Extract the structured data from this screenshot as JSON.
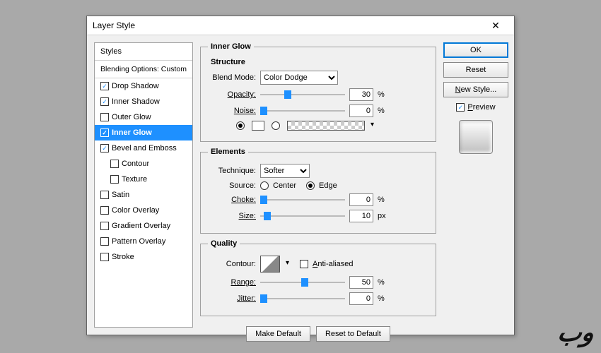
{
  "title": "Layer Style",
  "styles_header": "Styles",
  "blending_options": "Blending Options: Custom",
  "effects": [
    {
      "label": "Drop Shadow",
      "checked": true,
      "selected": false,
      "nest": false
    },
    {
      "label": "Inner Shadow",
      "checked": true,
      "selected": false,
      "nest": false
    },
    {
      "label": "Outer Glow",
      "checked": false,
      "selected": false,
      "nest": false
    },
    {
      "label": "Inner Glow",
      "checked": true,
      "selected": true,
      "nest": false
    },
    {
      "label": "Bevel and Emboss",
      "checked": true,
      "selected": false,
      "nest": false
    },
    {
      "label": "Contour",
      "checked": false,
      "selected": false,
      "nest": true
    },
    {
      "label": "Texture",
      "checked": false,
      "selected": false,
      "nest": true
    },
    {
      "label": "Satin",
      "checked": false,
      "selected": false,
      "nest": false
    },
    {
      "label": "Color Overlay",
      "checked": false,
      "selected": false,
      "nest": false
    },
    {
      "label": "Gradient Overlay",
      "checked": false,
      "selected": false,
      "nest": false
    },
    {
      "label": "Pattern Overlay",
      "checked": false,
      "selected": false,
      "nest": false
    },
    {
      "label": "Stroke",
      "checked": false,
      "selected": false,
      "nest": false
    }
  ],
  "panel_title": "Inner Glow",
  "structure": {
    "heading": "Structure",
    "blend_mode_label": "Blend Mode:",
    "blend_mode_value": "Color Dodge",
    "opacity_label": "Opacity:",
    "opacity_value": "30",
    "opacity_unit": "%",
    "noise_label": "Noise:",
    "noise_value": "0",
    "noise_unit": "%",
    "color_mode": "solid"
  },
  "elements": {
    "heading": "Elements",
    "technique_label": "Technique:",
    "technique_value": "Softer",
    "source_label": "Source:",
    "source_center": "Center",
    "source_edge": "Edge",
    "source_value": "Edge",
    "choke_label": "Choke:",
    "choke_value": "0",
    "choke_unit": "%",
    "size_label": "Size:",
    "size_value": "10",
    "size_unit": "px"
  },
  "quality": {
    "heading": "Quality",
    "contour_label": "Contour:",
    "antialiased_label": "Anti-aliased",
    "antialiased": false,
    "range_label": "Range:",
    "range_value": "50",
    "range_unit": "%",
    "jitter_label": "Jitter:",
    "jitter_value": "0",
    "jitter_unit": "%"
  },
  "buttons": {
    "make_default": "Make Default",
    "reset_default": "Reset to Default",
    "ok": "OK",
    "reset": "Reset",
    "new_style": "New Style...",
    "preview": "Preview"
  }
}
